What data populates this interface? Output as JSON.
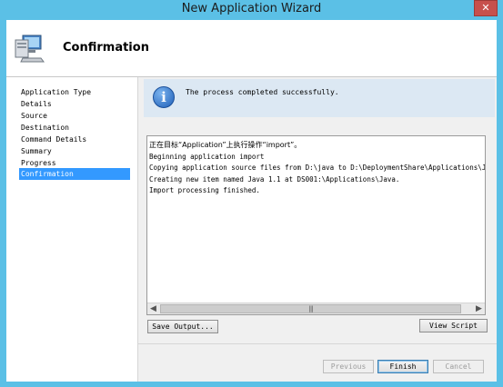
{
  "window": {
    "title": "New Application Wizard"
  },
  "header": {
    "title": "Confirmation",
    "icon": "computer-icon"
  },
  "sidebar": {
    "items": [
      {
        "label": "Application Type",
        "active": false
      },
      {
        "label": "Details",
        "active": false
      },
      {
        "label": "Source",
        "active": false
      },
      {
        "label": "Destination",
        "active": false
      },
      {
        "label": "Command Details",
        "active": false
      },
      {
        "label": "Summary",
        "active": false
      },
      {
        "label": "Progress",
        "active": false
      },
      {
        "label": "Confirmation",
        "active": true
      }
    ]
  },
  "status": {
    "icon": "info-icon",
    "message": "The process completed successfully."
  },
  "log": {
    "lines": [
      "正在目标“Application”上执行操作“import”。",
      "Beginning application import",
      "Copying application source files from D:\\java to D:\\DeploymentShare\\Applications\\J",
      "Creating new item named Java 1.1 at DS001:\\Applications\\Java.",
      "Import processing finished."
    ]
  },
  "buttons": {
    "save_output": "Save Output...",
    "view_script": "View Script",
    "previous": "Previous",
    "finish": "Finish",
    "cancel": "Cancel"
  },
  "colors": {
    "window_frame": "#5bc0e6",
    "selection": "#3399ff",
    "close_button": "#c7504c"
  }
}
